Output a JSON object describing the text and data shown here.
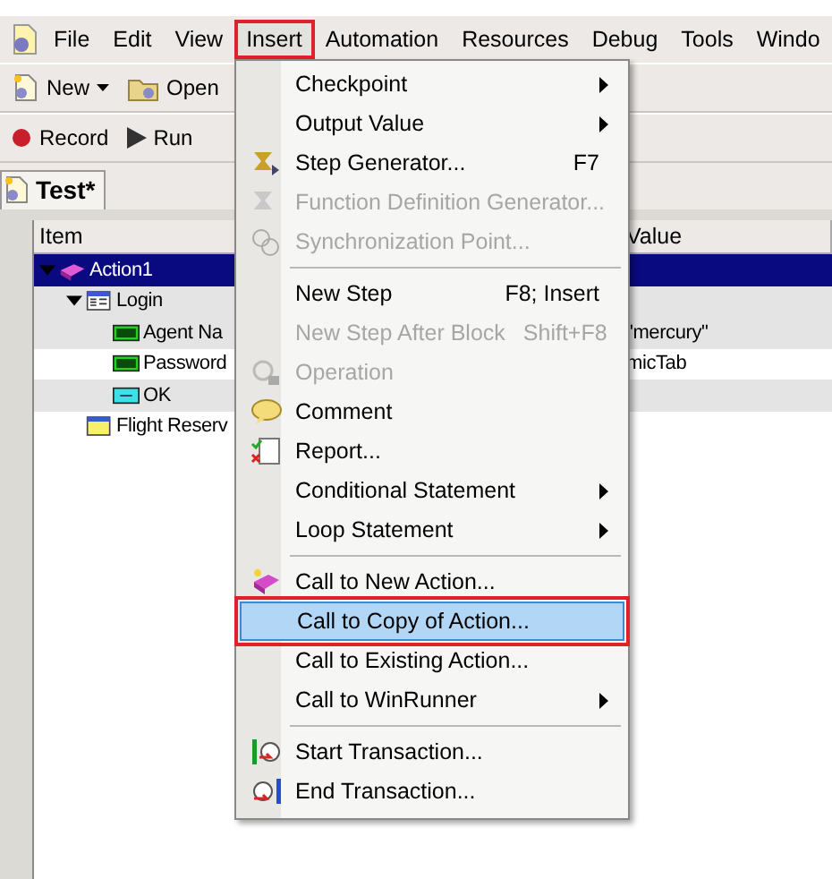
{
  "menubar": [
    {
      "label": "File",
      "selected": false
    },
    {
      "label": "Edit",
      "selected": false
    },
    {
      "label": "View",
      "selected": false
    },
    {
      "label": "Insert",
      "selected": true
    },
    {
      "label": "Automation",
      "selected": false
    },
    {
      "label": "Resources",
      "selected": false
    },
    {
      "label": "Debug",
      "selected": false
    },
    {
      "label": "Tools",
      "selected": false
    },
    {
      "label": "Windo",
      "selected": false
    }
  ],
  "toolbar_1": [
    {
      "label": "New",
      "kind": "new",
      "dropdown": true
    },
    {
      "label": "Open",
      "kind": "open",
      "dropdown": false
    }
  ],
  "toolbar_2": [
    {
      "label": "Record",
      "kind": "record"
    },
    {
      "label": "Run",
      "kind": "run"
    }
  ],
  "document_tab": {
    "label": "Test*"
  },
  "tree": {
    "columns": [
      "Item",
      "Value"
    ],
    "nodes": [
      {
        "label": "Action1",
        "kind": "action",
        "selected": true,
        "expanded": true,
        "children": [
          {
            "label": "Login",
            "kind": "dialog",
            "selected": false,
            "expanded": true,
            "children": [
              {
                "label": "Agent Na",
                "kind": "edit",
                "value": "\"mercury\"",
                "selected": false
              },
              {
                "label": "Password",
                "kind": "edit",
                "value": "micTab",
                "selected": false
              },
              {
                "label": "OK",
                "kind": "button",
                "selected": false
              }
            ]
          },
          {
            "label": "Flight Reserv",
            "kind": "window",
            "selected": false
          }
        ]
      }
    ]
  },
  "insert_menu": [
    {
      "kind": "plain",
      "label": "Checkpoint",
      "submenu": true,
      "disabled": false,
      "selected": false
    },
    {
      "kind": "plain",
      "label": "Output Value",
      "submenu": true,
      "disabled": false,
      "selected": false
    },
    {
      "kind": "generator",
      "label": "Step Generator...",
      "shortcut": "F7",
      "submenu": false,
      "disabled": false,
      "selected": false
    },
    {
      "kind": "function",
      "label": "Function Definition Generator...",
      "submenu": false,
      "disabled": true,
      "selected": false
    },
    {
      "kind": "sync",
      "label": "Synchronization Point...",
      "submenu": false,
      "disabled": true,
      "selected": false
    },
    {
      "kind": "separator"
    },
    {
      "kind": "plain",
      "label": "New Step",
      "shortcut": "F8; Insert",
      "submenu": false,
      "disabled": false,
      "selected": false
    },
    {
      "kind": "plain",
      "label": "New Step After Block",
      "shortcut": "Shift+F8",
      "submenu": false,
      "disabled": true,
      "selected": false
    },
    {
      "kind": "operation",
      "label": "Operation",
      "submenu": false,
      "disabled": true,
      "selected": false
    },
    {
      "kind": "comment",
      "label": "Comment",
      "submenu": false,
      "disabled": false,
      "selected": false
    },
    {
      "kind": "report",
      "label": "Report...",
      "submenu": false,
      "disabled": false,
      "selected": false
    },
    {
      "kind": "plain",
      "label": "Conditional Statement",
      "submenu": true,
      "disabled": false,
      "selected": false
    },
    {
      "kind": "plain",
      "label": "Loop Statement",
      "submenu": true,
      "disabled": false,
      "selected": false
    },
    {
      "kind": "separator"
    },
    {
      "kind": "action",
      "label": "Call to New Action...",
      "submenu": false,
      "disabled": false,
      "selected": false
    },
    {
      "kind": "plain",
      "label": "Call to Copy of Action...",
      "submenu": false,
      "disabled": false,
      "selected": true
    },
    {
      "kind": "plain",
      "label": "Call to Existing Action...",
      "submenu": false,
      "disabled": false,
      "selected": false
    },
    {
      "kind": "plain",
      "label": "Call to WinRunner",
      "submenu": true,
      "disabled": false,
      "selected": false
    },
    {
      "kind": "separator"
    },
    {
      "kind": "start",
      "label": "Start Transaction...",
      "submenu": false,
      "disabled": false,
      "selected": false
    },
    {
      "kind": "end",
      "label": "End Transaction...",
      "submenu": false,
      "disabled": false,
      "selected": false
    }
  ]
}
